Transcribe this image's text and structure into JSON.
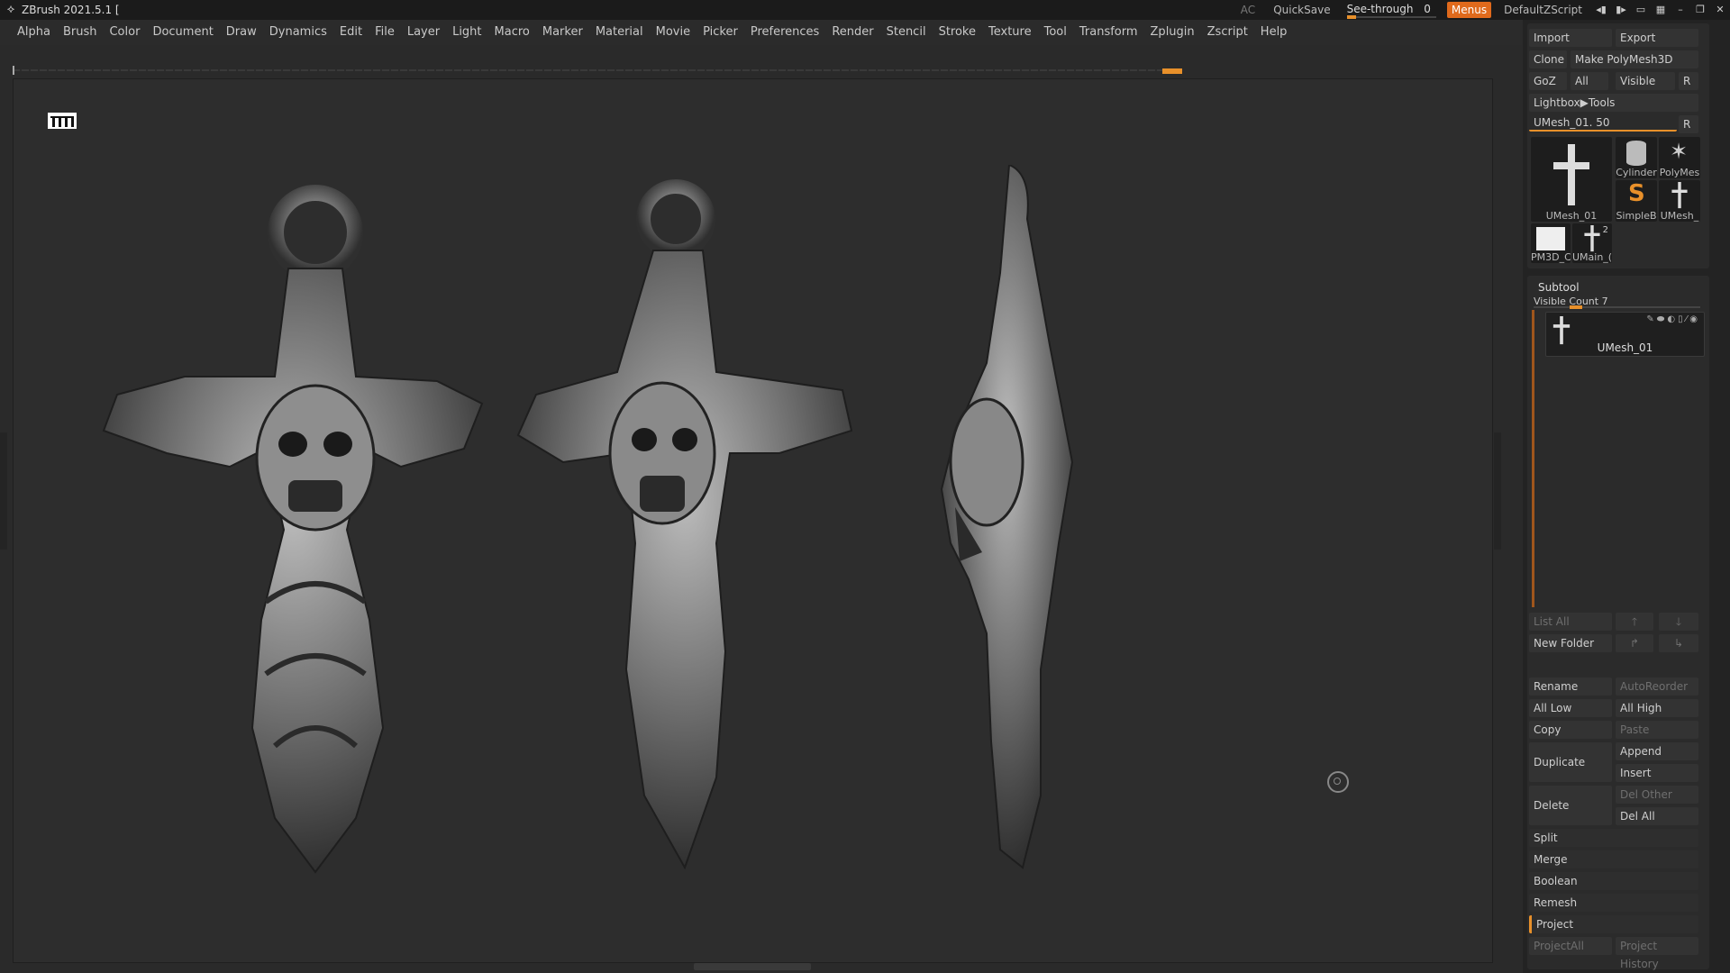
{
  "titlebar": {
    "title": "ZBrush 2021.5.1 [",
    "ac": "AC",
    "quicksave": "QuickSave",
    "seethrough_label": "See-through",
    "seethrough_value": "0",
    "menus": "Menus",
    "script": "DefaultZScript"
  },
  "menubar": {
    "items": [
      "Alpha",
      "Brush",
      "Color",
      "Document",
      "Draw",
      "Dynamics",
      "Edit",
      "File",
      "Layer",
      "Light",
      "Macro",
      "Marker",
      "Material",
      "Movie",
      "Picker",
      "Preferences",
      "Render",
      "Stencil",
      "Stroke",
      "Texture",
      "Tool",
      "Transform",
      "Zplugin",
      "Zscript",
      "Help"
    ]
  },
  "tool": {
    "import": "Import",
    "export": "Export",
    "clone": "Clone",
    "make_polymesh": "Make PolyMesh3D",
    "goz": "GoZ",
    "all": "All",
    "visible": "Visible",
    "r": "R",
    "lightbox_tools": "Lightbox▶Tools",
    "current_tool": "UMesh_01. 50",
    "thumbs": [
      "UMesh_01",
      "Cylinder",
      "PolyMes",
      "SimpleB",
      "UMesh_",
      "PM3D_C",
      "UMain_("
    ],
    "thumb_badge": "2"
  },
  "subtool": {
    "title": "Subtool",
    "visible_count": "Visible Count 7",
    "item_label": "UMesh_01",
    "list_all": "List All",
    "new_folder": "New Folder",
    "rename": "Rename",
    "autoreorder": "AutoReorder",
    "all_low": "All Low",
    "all_high": "All High",
    "copy": "Copy",
    "paste": "Paste",
    "duplicate": "Duplicate",
    "append": "Append",
    "insert": "Insert",
    "delete": "Delete",
    "del_other": "Del Other",
    "del_all": "Del All",
    "split": "Split",
    "merge": "Merge",
    "boolean": "Boolean",
    "remesh": "Remesh",
    "project": "Project",
    "projectall": "ProjectAll",
    "project_history": "Project History"
  },
  "colors": {
    "accent": "#e8902a",
    "menus_btn": "#e06a1c"
  }
}
